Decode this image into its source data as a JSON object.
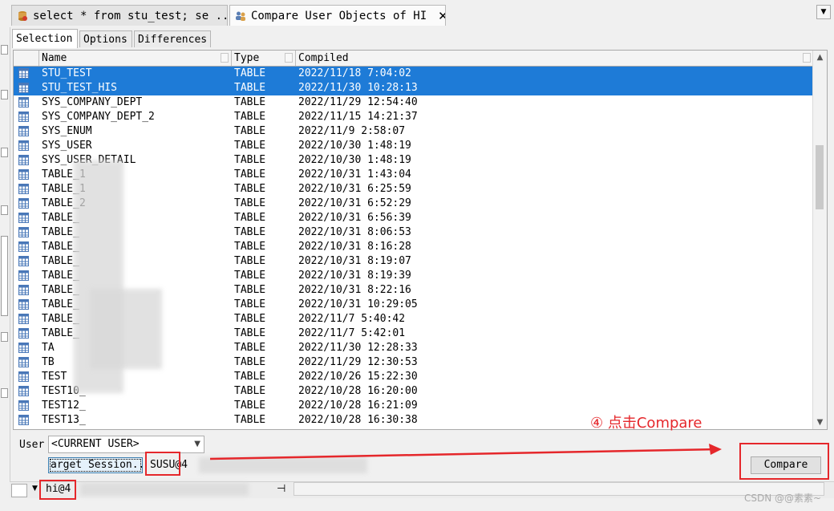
{
  "doc_tabs": [
    {
      "label": "select * from stu_test; se ...",
      "icon": "database-icon"
    },
    {
      "label": "Compare User Objects of HI",
      "icon": "users-icon"
    }
  ],
  "sub_tabs": [
    "Selection",
    "Options",
    "Differences"
  ],
  "columns": [
    "Name",
    "Type",
    "Compiled"
  ],
  "rows": [
    {
      "name": "STU_TEST",
      "type": "TABLE",
      "compiled": "2022/11/18 7:04:02",
      "selected": true
    },
    {
      "name": "STU_TEST_HIS",
      "type": "TABLE",
      "compiled": "2022/11/30 10:28:13",
      "selected": true
    },
    {
      "name": "SYS_COMPANY_DEPT",
      "type": "TABLE",
      "compiled": "2022/11/29 12:54:40"
    },
    {
      "name": "SYS_COMPANY_DEPT_2",
      "type": "TABLE",
      "compiled": "2022/11/15 14:21:37"
    },
    {
      "name": "SYS_ENUM",
      "type": "TABLE",
      "compiled": "2022/11/9 2:58:07"
    },
    {
      "name": "SYS_USER",
      "type": "TABLE",
      "compiled": "2022/10/30 1:48:19"
    },
    {
      "name": "SYS_USER_DETAIL",
      "type": "TABLE",
      "compiled": "2022/10/30 1:48:19"
    },
    {
      "name": "TABLE_1",
      "type": "TABLE",
      "compiled": "2022/10/31 1:43:04"
    },
    {
      "name": "TABLE_1",
      "type": "TABLE",
      "compiled": "2022/10/31 6:25:59"
    },
    {
      "name": "TABLE_2",
      "type": "TABLE",
      "compiled": "2022/10/31 6:52:29"
    },
    {
      "name": "TABLE_",
      "type": "TABLE",
      "compiled": "2022/10/31 6:56:39"
    },
    {
      "name": "TABLE_",
      "type": "TABLE",
      "compiled": "2022/10/31 8:06:53"
    },
    {
      "name": "TABLE_",
      "type": "TABLE",
      "compiled": "2022/10/31 8:16:28"
    },
    {
      "name": "TABLE_",
      "type": "TABLE",
      "compiled": "2022/10/31 8:19:07"
    },
    {
      "name": "TABLE_",
      "type": "TABLE",
      "compiled": "2022/10/31 8:19:39"
    },
    {
      "name": "TABLE_",
      "type": "TABLE",
      "compiled": "2022/10/31 8:22:16"
    },
    {
      "name": "TABLE_",
      "type": "TABLE",
      "compiled": "2022/10/31 10:29:05"
    },
    {
      "name": "TABLE_",
      "type": "TABLE",
      "compiled": "2022/11/7 5:40:42"
    },
    {
      "name": "TABLE_",
      "type": "TABLE",
      "compiled": "2022/11/7 5:42:01"
    },
    {
      "name": "TA",
      "type": "TABLE",
      "compiled": "2022/11/30 12:28:33"
    },
    {
      "name": "TB",
      "type": "TABLE",
      "compiled": "2022/11/29 12:30:53"
    },
    {
      "name": "TEST",
      "type": "TABLE",
      "compiled": "2022/10/26 15:22:30"
    },
    {
      "name": "TEST10_",
      "type": "TABLE",
      "compiled": "2022/10/28 16:20:00"
    },
    {
      "name": "TEST12_",
      "type": "TABLE",
      "compiled": "2022/10/28 16:21:09"
    },
    {
      "name": "TEST13_",
      "type": "TABLE",
      "compiled": "2022/10/28 16:30:38"
    }
  ],
  "user_label": "User",
  "user_value": "<CURRENT USER>",
  "target_session_label": "arget Session...",
  "session_text": "SUSU@4",
  "compare_label": "Compare",
  "connection_text": "hi@4",
  "annotation": "④ 点击Compare",
  "watermark": "CSDN @@素素~",
  "colors": {
    "selection": "#1e7bd7",
    "annotation": "#e5272b"
  }
}
